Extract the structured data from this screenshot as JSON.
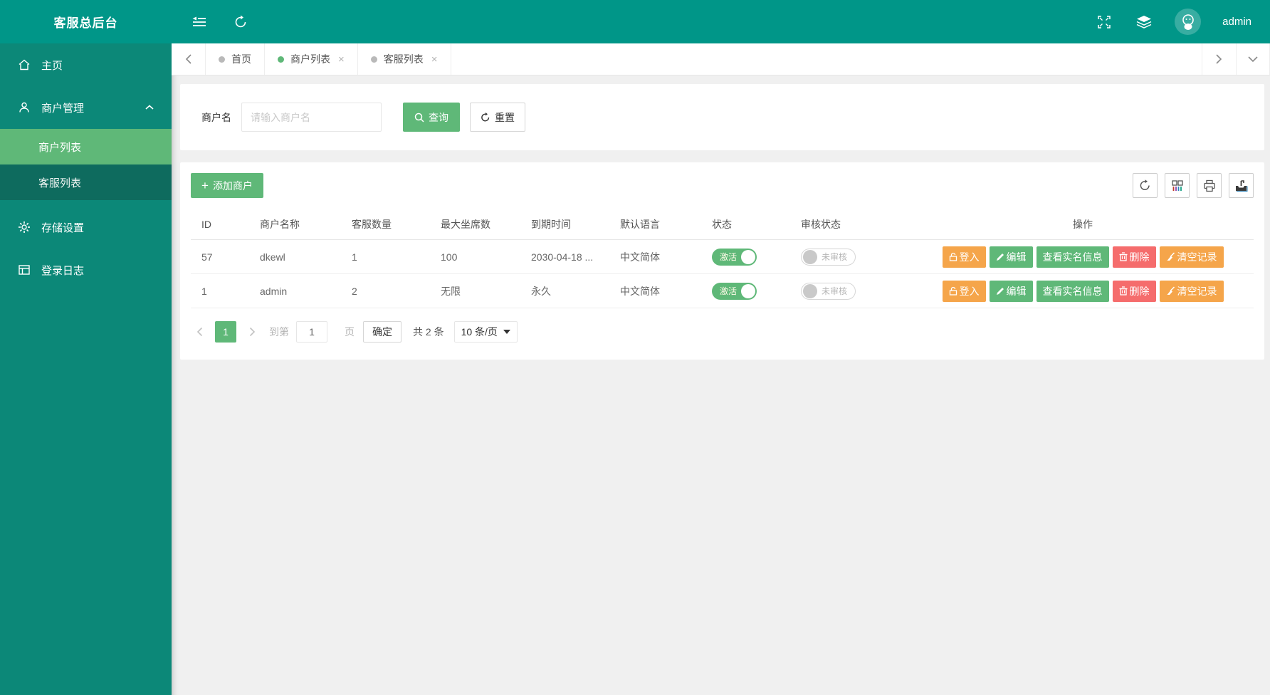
{
  "app": {
    "title": "客服总后台"
  },
  "colors": {
    "header_teal": "#009688",
    "sidebar_teal": "#0c8878",
    "accent_green": "#5FB878",
    "warn_orange": "#F5A54A",
    "danger_red": "#F56C6C"
  },
  "sidebar": {
    "items": [
      {
        "label": "主页",
        "icon": "home-icon"
      },
      {
        "label": "商户管理",
        "icon": "user-icon",
        "expanded": true,
        "children": [
          {
            "label": "商户列表",
            "active": true
          },
          {
            "label": "客服列表",
            "active": false
          }
        ]
      },
      {
        "label": "存储设置",
        "icon": "gear-icon"
      },
      {
        "label": "登录日志",
        "icon": "log-icon"
      }
    ]
  },
  "header": {
    "user": "admin"
  },
  "tabs": {
    "items": [
      {
        "label": "首页",
        "closable": false,
        "active": false
      },
      {
        "label": "商户列表",
        "closable": true,
        "active": true
      },
      {
        "label": "客服列表",
        "closable": true,
        "active": false
      }
    ]
  },
  "search": {
    "label": "商户名",
    "placeholder": "请输入商户名",
    "value": "",
    "query_label": "查询",
    "reset_label": "重置"
  },
  "toolbar": {
    "add_label": "添加商户",
    "icons": [
      "refresh-icon",
      "columns-filter-icon",
      "print-icon",
      "export-icon"
    ]
  },
  "table": {
    "headers": [
      "ID",
      "商户名称",
      "客服数量",
      "最大坐席数",
      "到期时间",
      "默认语言",
      "状态",
      "审核状态",
      "操作"
    ],
    "rows": [
      {
        "id": "57",
        "name": "dkewl",
        "agents": "1",
        "seats": "100",
        "expire": "2030-04-18 ...",
        "lang": "中文简体"
      },
      {
        "id": "1",
        "name": "admin",
        "agents": "2",
        "seats": "无限",
        "expire": "永久",
        "lang": "中文简体"
      }
    ]
  },
  "switches": {
    "active_label": "激活",
    "unaudited_label": "未审核"
  },
  "row_actions": {
    "login": "登入",
    "edit": "编辑",
    "view_real": "查看实名信息",
    "delete": "删除",
    "clear": "清空记录"
  },
  "pagination": {
    "page": "1",
    "goto_prefix": "到第",
    "goto_value": "1",
    "goto_suffix": "页",
    "confirm_label": "确定",
    "total_label": "共 2 条",
    "per_page_label": "10 条/页"
  }
}
